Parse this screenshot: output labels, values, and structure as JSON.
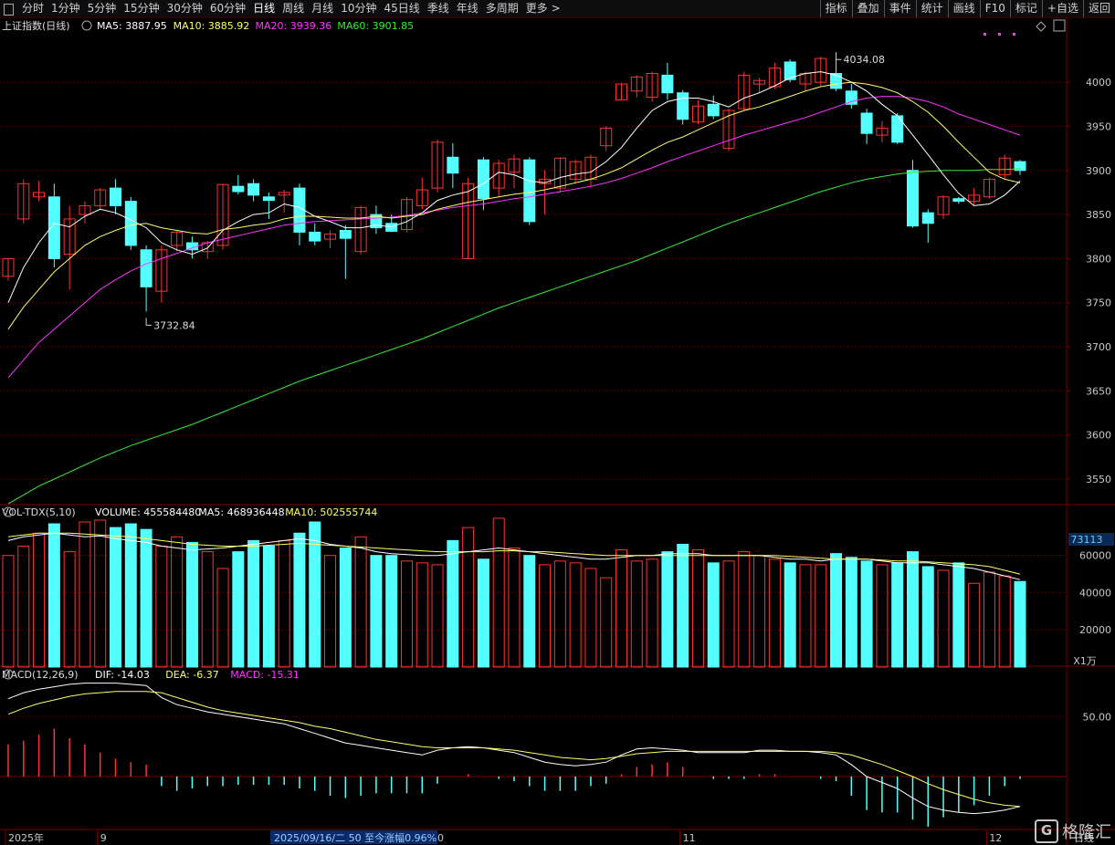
{
  "toolbar": {
    "periods": [
      "分时",
      "1分钟",
      "5分钟",
      "15分钟",
      "30分钟",
      "60分钟",
      "日线",
      "周线",
      "月线",
      "10分钟",
      "45日线",
      "季线",
      "年线",
      "多周期"
    ],
    "active": "日线",
    "more": "更多 >",
    "right": [
      "指标",
      "叠加",
      "事件",
      "统计",
      "画线",
      "F10",
      "标记",
      "+自选",
      "返回"
    ]
  },
  "chart_data": {
    "type": "candlestick",
    "title": "上证指数(日线)",
    "ma_legend": [
      {
        "label": "MA5: 3887.95",
        "color": "#ffffff"
      },
      {
        "label": "MA10: 3885.92",
        "color": "#ffff66"
      },
      {
        "label": "MA20: 3939.36",
        "color": "#ff33ff"
      },
      {
        "label": "MA60: 3901.85",
        "color": "#33ee33"
      }
    ],
    "y_ticks": [
      4000,
      3950,
      3900,
      3850,
      3800,
      3750,
      3700,
      3650,
      3600,
      3550
    ],
    "ylim": [
      3520,
      4055
    ],
    "candles": [
      {
        "o": 3780,
        "h": 3800,
        "l": 3775,
        "c": 3800
      },
      {
        "o": 3845,
        "h": 3890,
        "l": 3840,
        "c": 3885
      },
      {
        "o": 3870,
        "h": 3888,
        "l": 3865,
        "c": 3875
      },
      {
        "o": 3870,
        "h": 3885,
        "l": 3790,
        "c": 3800
      },
      {
        "o": 3805,
        "h": 3860,
        "l": 3765,
        "c": 3845
      },
      {
        "o": 3850,
        "h": 3865,
        "l": 3840,
        "c": 3860
      },
      {
        "o": 3860,
        "h": 3880,
        "l": 3855,
        "c": 3878
      },
      {
        "o": 3880,
        "h": 3890,
        "l": 3850,
        "c": 3860
      },
      {
        "o": 3865,
        "h": 3870,
        "l": 3810,
        "c": 3815
      },
      {
        "o": 3810,
        "h": 3815,
        "l": 3740,
        "c": 3768
      },
      {
        "o": 3763,
        "h": 3815,
        "l": 3750,
        "c": 3810
      },
      {
        "o": 3815,
        "h": 3832,
        "l": 3808,
        "c": 3830
      },
      {
        "o": 3818,
        "h": 3825,
        "l": 3800,
        "c": 3810
      },
      {
        "o": 3808,
        "h": 3820,
        "l": 3800,
        "c": 3818
      },
      {
        "o": 3815,
        "h": 3885,
        "l": 3810,
        "c": 3884
      },
      {
        "o": 3882,
        "h": 3895,
        "l": 3873,
        "c": 3876
      },
      {
        "o": 3885,
        "h": 3890,
        "l": 3865,
        "c": 3872
      },
      {
        "o": 3870,
        "h": 3875,
        "l": 3845,
        "c": 3866
      },
      {
        "o": 3872,
        "h": 3878,
        "l": 3852,
        "c": 3875
      },
      {
        "o": 3880,
        "h": 3885,
        "l": 3815,
        "c": 3830
      },
      {
        "o": 3830,
        "h": 3840,
        "l": 3815,
        "c": 3820
      },
      {
        "o": 3822,
        "h": 3832,
        "l": 3812,
        "c": 3828
      },
      {
        "o": 3832,
        "h": 3838,
        "l": 3777,
        "c": 3823
      },
      {
        "o": 3808,
        "h": 3860,
        "l": 3805,
        "c": 3858
      },
      {
        "o": 3850,
        "h": 3860,
        "l": 3828,
        "c": 3835
      },
      {
        "o": 3840,
        "h": 3850,
        "l": 3830,
        "c": 3831
      },
      {
        "o": 3833,
        "h": 3870,
        "l": 3830,
        "c": 3867
      },
      {
        "o": 3860,
        "h": 3892,
        "l": 3856,
        "c": 3878
      },
      {
        "o": 3880,
        "h": 3935,
        "l": 3875,
        "c": 3932
      },
      {
        "o": 3915,
        "h": 3931,
        "l": 3880,
        "c": 3897
      },
      {
        "o": 3800,
        "h": 3892,
        "l": 3800,
        "c": 3885
      },
      {
        "o": 3912,
        "h": 3915,
        "l": 3855,
        "c": 3868
      },
      {
        "o": 3880,
        "h": 3912,
        "l": 3870,
        "c": 3908
      },
      {
        "o": 3898,
        "h": 3918,
        "l": 3880,
        "c": 3913
      },
      {
        "o": 3912,
        "h": 3915,
        "l": 3838,
        "c": 3842
      },
      {
        "o": 3885,
        "h": 3900,
        "l": 3850,
        "c": 3890
      },
      {
        "o": 3880,
        "h": 3915,
        "l": 3875,
        "c": 3914
      },
      {
        "o": 3890,
        "h": 3912,
        "l": 3885,
        "c": 3910
      },
      {
        "o": 3890,
        "h": 3918,
        "l": 3882,
        "c": 3915
      },
      {
        "o": 3928,
        "h": 3950,
        "l": 3922,
        "c": 3948
      },
      {
        "o": 3980,
        "h": 3999,
        "l": 3980,
        "c": 3998
      },
      {
        "o": 3990,
        "h": 4008,
        "l": 3983,
        "c": 4006
      },
      {
        "o": 3983,
        "h": 4012,
        "l": 3978,
        "c": 4010
      },
      {
        "o": 4008,
        "h": 4022,
        "l": 3980,
        "c": 3988
      },
      {
        "o": 3988,
        "h": 3991,
        "l": 3952,
        "c": 3958
      },
      {
        "o": 3955,
        "h": 3980,
        "l": 3952,
        "c": 3973
      },
      {
        "o": 3975,
        "h": 3985,
        "l": 3958,
        "c": 3962
      },
      {
        "o": 3925,
        "h": 3970,
        "l": 3922,
        "c": 3968
      },
      {
        "o": 3970,
        "h": 4012,
        "l": 3968,
        "c": 4008
      },
      {
        "o": 3998,
        "h": 4005,
        "l": 3988,
        "c": 4002
      },
      {
        "o": 3995,
        "h": 4022,
        "l": 3992,
        "c": 4016
      },
      {
        "o": 4023,
        "h": 4026,
        "l": 4000,
        "c": 4003
      },
      {
        "o": 3998,
        "h": 4012,
        "l": 3990,
        "c": 4010
      },
      {
        "o": 4000,
        "h": 4029,
        "l": 3996,
        "c": 4027
      },
      {
        "o": 4010,
        "h": 4034,
        "l": 3990,
        "c": 3993
      },
      {
        "o": 3990,
        "h": 3998,
        "l": 3970,
        "c": 3975
      },
      {
        "o": 3965,
        "h": 3970,
        "l": 3930,
        "c": 3942
      },
      {
        "o": 3940,
        "h": 3956,
        "l": 3932,
        "c": 3948
      },
      {
        "o": 3962,
        "h": 3965,
        "l": 3930,
        "c": 3932
      },
      {
        "o": 3900,
        "h": 3912,
        "l": 3835,
        "c": 3837
      },
      {
        "o": 3852,
        "h": 3856,
        "l": 3818,
        "c": 3840
      },
      {
        "o": 3850,
        "h": 3872,
        "l": 3845,
        "c": 3870
      },
      {
        "o": 3868,
        "h": 3870,
        "l": 3862,
        "c": 3865
      },
      {
        "o": 3865,
        "h": 3880,
        "l": 3860,
        "c": 3872
      },
      {
        "o": 3870,
        "h": 3892,
        "l": 3868,
        "c": 3890
      },
      {
        "o": 3895,
        "h": 3918,
        "l": 3890,
        "c": 3914
      },
      {
        "o": 3910,
        "h": 3912,
        "l": 3895,
        "c": 3900
      }
    ],
    "ma5": [
      3750,
      3790,
      3818,
      3840,
      3836,
      3848,
      3856,
      3852,
      3844,
      3835,
      3818,
      3810,
      3805,
      3812,
      3832,
      3842,
      3850,
      3852,
      3862,
      3858,
      3848,
      3842,
      3835,
      3835,
      3838,
      3836,
      3842,
      3852,
      3866,
      3872,
      3876,
      3885,
      3898,
      3895,
      3888,
      3886,
      3892,
      3896,
      3898,
      3910,
      3926,
      3948,
      3968,
      3978,
      3982,
      3982,
      3978,
      3972,
      3982,
      3988,
      3996,
      4005,
      4010,
      4012,
      4008,
      4000,
      3990,
      3975,
      3962,
      3940,
      3918,
      3895,
      3874,
      3860,
      3862,
      3872,
      3888
    ],
    "ma10": [
      3720,
      3745,
      3765,
      3785,
      3800,
      3815,
      3825,
      3832,
      3838,
      3840,
      3835,
      3832,
      3829,
      3828,
      3833,
      3835,
      3838,
      3840,
      3845,
      3848,
      3848,
      3847,
      3846,
      3846,
      3848,
      3846,
      3848,
      3850,
      3856,
      3860,
      3864,
      3867,
      3870,
      3873,
      3875,
      3878,
      3882,
      3886,
      3890,
      3896,
      3903,
      3913,
      3923,
      3932,
      3938,
      3946,
      3954,
      3962,
      3968,
      3972,
      3978,
      3984,
      3990,
      3995,
      3998,
      4000,
      3998,
      3994,
      3988,
      3978,
      3966,
      3950,
      3932,
      3915,
      3898,
      3890,
      3886
    ],
    "ma20": [
      3665,
      3685,
      3705,
      3720,
      3735,
      3750,
      3765,
      3776,
      3786,
      3794,
      3800,
      3806,
      3812,
      3818,
      3822,
      3826,
      3830,
      3834,
      3838,
      3840,
      3842,
      3843,
      3844,
      3845,
      3846,
      3847,
      3849,
      3852,
      3855,
      3858,
      3860,
      3862,
      3865,
      3868,
      3870,
      3873,
      3876,
      3879,
      3882,
      3886,
      3891,
      3897,
      3903,
      3910,
      3916,
      3922,
      3928,
      3934,
      3940,
      3945,
      3950,
      3955,
      3960,
      3966,
      3972,
      3978,
      3982,
      3984,
      3984,
      3982,
      3978,
      3972,
      3964,
      3958,
      3952,
      3946,
      3940
    ],
    "ma60": [
      3522,
      3532,
      3542,
      3550,
      3558,
      3566,
      3574,
      3581,
      3588,
      3594,
      3600,
      3606,
      3612,
      3619,
      3626,
      3633,
      3640,
      3647,
      3654,
      3661,
      3667,
      3673,
      3679,
      3685,
      3691,
      3697,
      3703,
      3709,
      3716,
      3723,
      3730,
      3737,
      3744,
      3750,
      3756,
      3762,
      3768,
      3774,
      3780,
      3786,
      3792,
      3798,
      3805,
      3812,
      3819,
      3826,
      3833,
      3840,
      3846,
      3852,
      3858,
      3864,
      3870,
      3876,
      3881,
      3886,
      3890,
      3893,
      3896,
      3898,
      3899,
      3900,
      3900,
      3900,
      3901,
      3901,
      3902
    ],
    "annotations": [
      {
        "label": "4034.08",
        "index": 54,
        "value": 4034.08
      },
      {
        "label": "3732.84",
        "index": 9,
        "value": 3732.84
      }
    ],
    "volume": {
      "title": "VOL-TDX(5,10)",
      "legend": [
        {
          "label": "VOLUME: 455584480",
          "color": "#ffffff"
        },
        {
          "label": "MA5: 468936448",
          "color": "#ffffff"
        },
        {
          "label": "MA10: 502555744",
          "color": "#ffff66"
        }
      ],
      "y_ticks": [
        60000,
        40000,
        20000
      ],
      "ylim": [
        0,
        78000
      ],
      "badge": "73113",
      "unit": "X1万",
      "values": [
        60000,
        65000,
        72000,
        77000,
        62000,
        78000,
        79000,
        75000,
        77000,
        74000,
        65000,
        70000,
        67000,
        62000,
        53000,
        62000,
        68000,
        65000,
        68000,
        72000,
        78000,
        60000,
        64000,
        70000,
        60000,
        60000,
        57000,
        56000,
        55000,
        68000,
        75000,
        58000,
        80000,
        64000,
        60000,
        55000,
        57000,
        56000,
        53000,
        48000,
        63000,
        57000,
        58000,
        62000,
        66000,
        63000,
        56000,
        57000,
        62000,
        60000,
        58000,
        56000,
        55000,
        55000,
        61000,
        59000,
        57000,
        55000,
        56000,
        62000,
        54000,
        52000,
        56000,
        45000,
        51000,
        49000,
        46000
      ],
      "ma5": [
        68000,
        70000,
        71000,
        72000,
        71000,
        70000,
        70500,
        69000,
        68000,
        67000,
        65000,
        64000,
        63000,
        63500,
        64000,
        65000,
        66000,
        67000,
        68000,
        69000,
        68000,
        66000,
        65000,
        64000,
        62000,
        61000,
        60500,
        60000,
        60000,
        61000,
        62000,
        63000,
        64000,
        63000,
        62000,
        61000,
        60000,
        59000,
        58000,
        58000,
        59000,
        60000,
        60000,
        61000,
        61000,
        61000,
        60000,
        60000,
        60000,
        60000,
        59000,
        58000,
        58000,
        57000,
        58000,
        58000,
        58000,
        57000,
        56000,
        56000,
        56000,
        55000,
        54000,
        53000,
        51000,
        49000,
        47000
      ],
      "ma10": [
        70000,
        71000,
        72000,
        72000,
        72000,
        71500,
        71000,
        70500,
        70000,
        69000,
        68000,
        67000,
        66000,
        65500,
        65000,
        65000,
        65000,
        65500,
        66000,
        66500,
        66000,
        65500,
        65000,
        64500,
        64000,
        63500,
        63000,
        62500,
        62000,
        62000,
        62000,
        62000,
        62500,
        62500,
        62000,
        62000,
        61500,
        61000,
        60500,
        60000,
        60000,
        60000,
        60000,
        60000,
        60000,
        60000,
        60000,
        60000,
        60000,
        60000,
        60000,
        59500,
        59000,
        58500,
        58000,
        58000,
        58000,
        57500,
        57000,
        57000,
        56500,
        56000,
        55500,
        55000,
        54000,
        52000,
        50000
      ]
    },
    "macd": {
      "title": "MACD(12,26,9)",
      "legend": [
        {
          "label": "DIF: -14.03",
          "color": "#ffffff"
        },
        {
          "label": "DEA: -6.37",
          "color": "#ffff66"
        },
        {
          "label": "MACD: -15.31",
          "color": "#ff33ff"
        }
      ],
      "y_ticks": [
        50.0
      ],
      "ylim": [
        -45,
        80
      ],
      "dif": [
        65,
        70,
        73,
        75,
        77,
        78,
        78,
        78,
        77,
        76,
        66,
        60,
        57,
        54,
        52,
        50,
        48,
        46,
        44,
        40,
        36,
        32,
        28,
        26,
        24,
        22,
        20,
        18,
        22,
        24,
        25,
        24,
        22,
        20,
        16,
        12,
        10,
        9,
        10,
        12,
        18,
        23,
        24,
        23,
        22,
        20,
        20,
        20,
        20,
        22,
        22,
        21,
        21,
        20,
        18,
        10,
        0,
        -5,
        -10,
        -18,
        -25,
        -28,
        -30,
        -31,
        -30,
        -28,
        -25
      ],
      "dea": [
        52,
        57,
        61,
        64,
        67,
        69,
        70,
        71,
        71,
        71,
        70,
        66,
        62,
        58,
        55,
        53,
        51,
        49,
        47,
        45,
        42,
        40,
        37,
        34,
        31,
        29,
        27,
        25,
        24,
        24,
        24,
        24,
        23,
        22,
        20,
        18,
        16,
        15,
        14,
        15,
        17,
        19,
        20,
        21,
        21,
        21,
        21,
        21,
        21,
        21,
        21,
        21,
        21,
        21,
        20,
        18,
        14,
        10,
        5,
        0,
        -6,
        -11,
        -15,
        -19,
        -22,
        -24,
        -25
      ],
      "hist": [
        27,
        30,
        35,
        40,
        32,
        27,
        20,
        15,
        12,
        10,
        -8,
        -12,
        -10,
        -8,
        -8,
        -7,
        -7,
        -7,
        -7,
        -10,
        -12,
        -16,
        -18,
        -16,
        -14,
        -14,
        -14,
        -14,
        -6,
        0,
        2,
        0,
        -2,
        -4,
        -8,
        -12,
        -12,
        -12,
        -8,
        -6,
        2,
        8,
        10,
        12,
        8,
        0,
        -2,
        -2,
        -2,
        2,
        2,
        0,
        0,
        -2,
        -4,
        -16,
        -28,
        -30,
        -30,
        -36,
        -42,
        -34,
        -30,
        -24,
        -16,
        -8,
        -2
      ]
    }
  },
  "x_axis": {
    "labels": [
      {
        "text": "2025年",
        "index": 0
      },
      {
        "text": "9",
        "index": 6
      },
      {
        "text": "0",
        "index": 28
      },
      {
        "text": "11",
        "index": 44
      },
      {
        "text": "12",
        "index": 64
      }
    ],
    "cursor_info": "2025/09/16/二 50 至今涨幅0.96%",
    "right_label": "日线"
  },
  "colors": {
    "up": "#ff3232",
    "down": "#54ffff",
    "grid": "#7a0000",
    "text": "#c8c8c8"
  },
  "watermark": {
    "text": "格隆汇",
    "logo": "G"
  }
}
